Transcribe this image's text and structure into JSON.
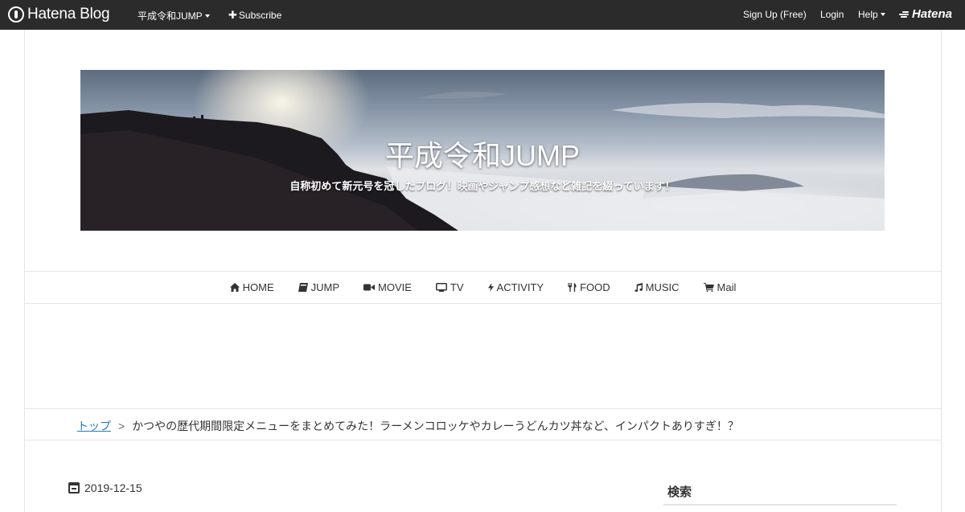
{
  "topbar": {
    "logo_text": "Hatena Blog",
    "blog_name": "平成令和JUMP",
    "subscribe_label": "Subscribe",
    "signup_label": "Sign Up (Free)",
    "login_label": "Login",
    "help_label": "Help",
    "hatena_label": "Hatena"
  },
  "header": {
    "title": "平成令和JUMP",
    "description": "自称初めて新元号を冠したブログ！映画やジャンプ感想など雑記を綴っています！"
  },
  "nav": {
    "items": [
      {
        "label": "HOME",
        "icon": "home-icon"
      },
      {
        "label": "JUMP",
        "icon": "book-icon"
      },
      {
        "label": "MOVIE",
        "icon": "video-camera-icon"
      },
      {
        "label": "TV",
        "icon": "tv-icon"
      },
      {
        "label": "ACTIVITY",
        "icon": "bolt-icon"
      },
      {
        "label": "FOOD",
        "icon": "cutlery-icon"
      },
      {
        "label": "MUSIC",
        "icon": "music-note-icon"
      },
      {
        "label": "Mail",
        "icon": "cart-icon"
      }
    ]
  },
  "breadcrumb": {
    "top_label": "トップ",
    "separator": ">",
    "current": "かつやの歴代期間限定メニューをまとめてみた！ラーメンコロッケやカレーうどんカツ丼など、インパクトありすぎ！？"
  },
  "article": {
    "date": "2019-12-15"
  },
  "sidebar": {
    "search_title": "検索"
  }
}
